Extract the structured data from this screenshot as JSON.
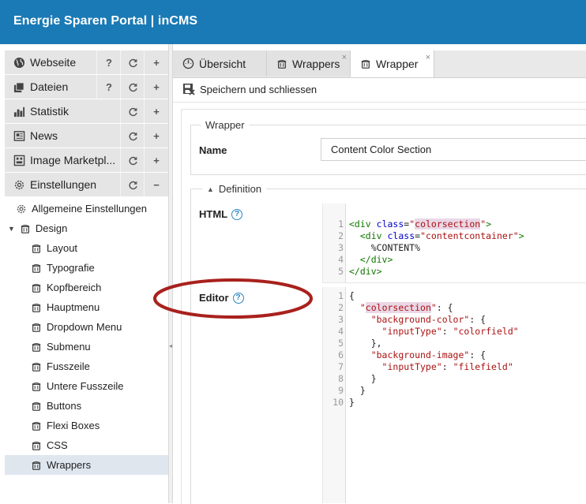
{
  "header": {
    "title": "Energie Sparen Portal | inCMS"
  },
  "sidebar": {
    "sections": [
      {
        "label": "Webseite",
        "icon": "globe-icon",
        "has_help": true
      },
      {
        "label": "Dateien",
        "icon": "files-icon",
        "has_help": true
      },
      {
        "label": "Statistik",
        "icon": "bar-chart-icon",
        "has_help": false
      },
      {
        "label": "News",
        "icon": "newspaper-icon",
        "has_help": false
      },
      {
        "label": "Image Marketpl...",
        "icon": "image-market-icon",
        "has_help": false
      },
      {
        "label": "Einstellungen",
        "icon": "gear-icon",
        "has_help": false,
        "expanded": true
      }
    ],
    "help_symbol": "?",
    "add_symbol": "+",
    "collapse_symbol": "−",
    "tree": {
      "general_settings": "Allgemeine Einstellungen",
      "design": "Design",
      "design_items": [
        "Layout",
        "Typografie",
        "Kopfbereich",
        "Hauptmenu",
        "Dropdown Menu",
        "Submenu",
        "Fusszeile",
        "Untere Fusszeile",
        "Buttons",
        "Flexi Boxes",
        "CSS",
        "Wrappers"
      ],
      "selected": "Wrappers"
    }
  },
  "tabs": [
    {
      "label": "Übersicht",
      "icon": "dashboard-icon",
      "closable": false,
      "active": false
    },
    {
      "label": "Wrappers",
      "icon": "wrapper-icon",
      "closable": true,
      "active": false
    },
    {
      "label": "Wrapper",
      "icon": "wrapper-icon",
      "closable": true,
      "active": true
    }
  ],
  "close_symbol": "×",
  "toolbar": {
    "save_close_label": "Speichern und schliessen"
  },
  "form": {
    "wrapper_legend": "Wrapper",
    "name_label": "Name",
    "name_value": "Content Color Section",
    "definition_legend": "Definition",
    "html_label": "HTML",
    "editor_label": "Editor",
    "help_symbol": "?"
  },
  "html_code": [
    "<div class=\"colorsection\">",
    "  <div class=\"contentcontainer\">",
    "    %CONTENT%",
    "  </div>",
    "</div>"
  ],
  "editor_code": [
    "{",
    "  \"colorsection\": {",
    "    \"background-color\": {",
    "      \"inputType\": \"colorfield\"",
    "    },",
    "    \"background-image\": {",
    "      \"inputType\": \"filefield\"",
    "    }",
    "  }",
    "}"
  ],
  "colors": {
    "header": "#1a7ab5",
    "annotation_ellipse": "#a8211d",
    "help_icon": "#2a86c4",
    "selected_row": "#dfe6ee"
  }
}
